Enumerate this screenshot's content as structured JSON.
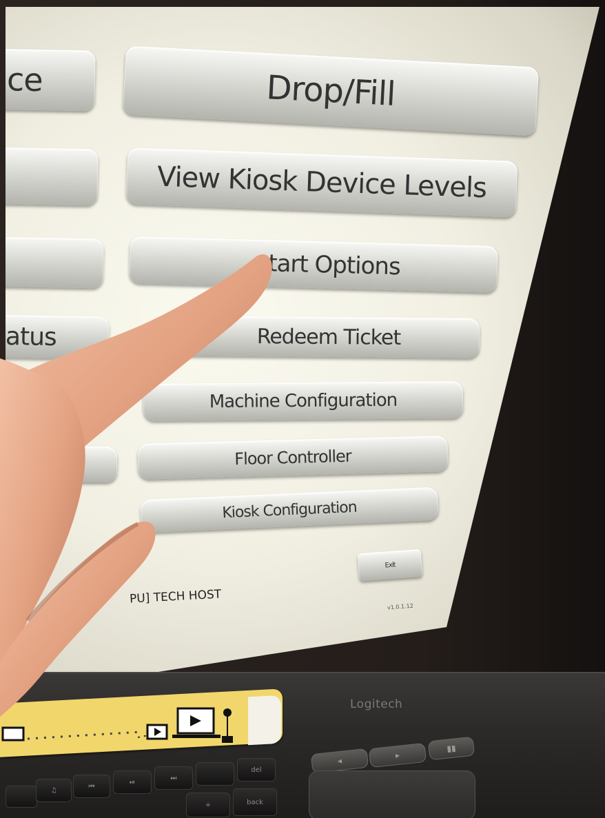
{
  "screen": {
    "left_buttons": [
      "ce",
      "",
      "",
      "atus",
      "",
      ""
    ],
    "right_buttons": [
      "Drop/Fill",
      "View Kiosk Device Levels",
      "tart Options",
      "Redeem Ticket",
      "Machine Configuration",
      "Floor Controller",
      "Kiosk Configuration"
    ],
    "exit_label": "Exit",
    "footer_host": "PU] TECH HOST",
    "version": "v1.0.1.12"
  },
  "keyboard": {
    "brand": "Logitech",
    "keys": [
      "♫",
      "⏮",
      "⏯",
      "⏭",
      "",
      "del",
      "+",
      "back"
    ]
  },
  "colors": {
    "screen_glow": "#f5f3e6",
    "button_face": "#d9d9d4",
    "label_yellow": "#f1d66c",
    "skin": "#e8a98a"
  },
  "icons": [
    "monitor-play-icon",
    "plant-icon",
    "dotted-connection-icon"
  ]
}
